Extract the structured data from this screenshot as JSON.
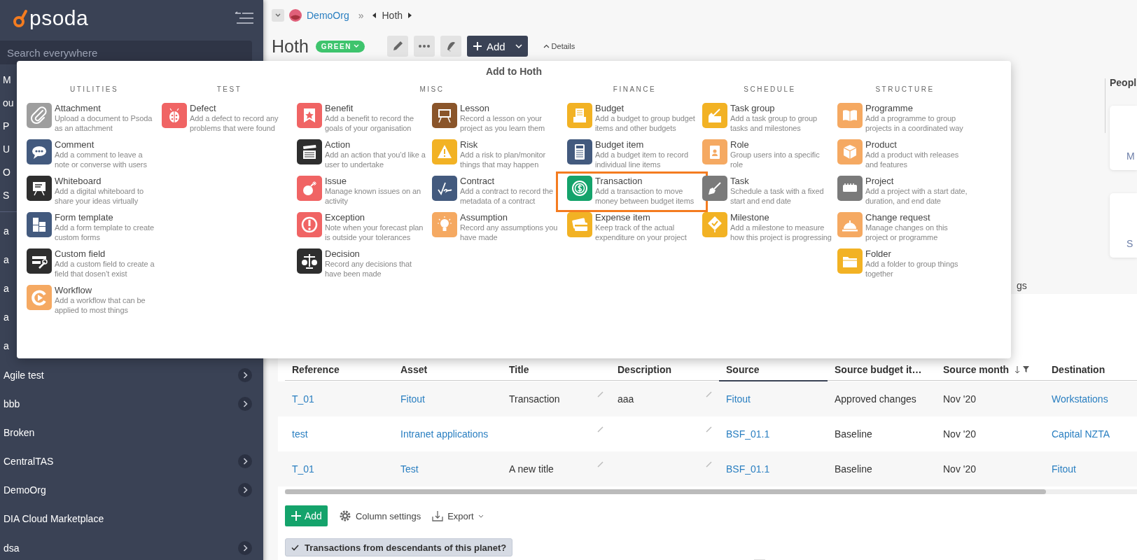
{
  "sidebar": {
    "logo": "psoda",
    "search": {
      "placeholder": "Search everywhere"
    },
    "fragments": [
      "M",
      "ou",
      "P",
      "U",
      "O",
      "S"
    ],
    "covered_items": [
      "a",
      "a",
      "a",
      "a",
      "a"
    ],
    "items": [
      {
        "label": "Agile test",
        "has_children": true
      },
      {
        "label": "bbb",
        "has_children": true
      },
      {
        "label": "Broken",
        "has_children": false
      },
      {
        "label": "CentralTAS",
        "has_children": true
      },
      {
        "label": "DemoOrg",
        "has_children": true
      },
      {
        "label": "DIA Cloud Marketplace",
        "has_children": false
      },
      {
        "label": "dsa",
        "has_children": true
      }
    ]
  },
  "breadcrumb": {
    "org": "DemoOrg",
    "separator": "»",
    "current": "Hoth"
  },
  "page": {
    "title": "Hoth",
    "status": {
      "label": "GREEN",
      "color": "#3ec46d"
    },
    "add_button": "Add",
    "details_link": "Details"
  },
  "side_panel": {
    "label_fragment": "gs",
    "heading": "Peopl",
    "cards": [
      "M",
      "S"
    ]
  },
  "add_menu": {
    "title": "Add to Hoth",
    "sections": [
      {
        "title": "UTILITIES",
        "columns": [
          [
            {
              "label": "Attachment",
              "description": "Upload a document to Psoda as an attachment",
              "color": "#9e9e9e",
              "highlighted": false
            },
            {
              "label": "Comment",
              "description": "Add a comment to leave a note or converse with users",
              "color": "#435a7e",
              "highlighted": false
            },
            {
              "label": "Whiteboard",
              "description": "Add a digital whiteboard to share your ideas virtually",
              "color": "#2e2e2e",
              "highlighted": false
            },
            {
              "label": "Form template",
              "description": "Add a form template to create custom forms",
              "color": "#435a7e",
              "highlighted": false
            },
            {
              "label": "Custom field",
              "description": "Add a custom field to create a field that dosen’t exist",
              "color": "#2e2e2e",
              "highlighted": false
            },
            {
              "label": "Workflow",
              "description": "Add a workflow that can be applied to most things",
              "color": "#f5a962",
              "highlighted": false
            }
          ]
        ]
      },
      {
        "title": "TEST",
        "columns": [
          [
            {
              "label": "Defect",
              "description": "Add a defect to record any problems that were found",
              "color": "#f06464",
              "highlighted": false
            }
          ]
        ]
      },
      {
        "title": "MISC",
        "columns": [
          [
            {
              "label": "Benefit",
              "description": "Add a benefit to record the goals of your organisation",
              "color": "#f06464",
              "highlighted": false
            },
            {
              "label": "Action",
              "description": "Add an action that you’d like a user to undertake",
              "color": "#2e2e2e",
              "highlighted": false
            },
            {
              "label": "Issue",
              "description": "Manage known issues on an activity",
              "color": "#f06464",
              "highlighted": false
            },
            {
              "label": "Exception",
              "description": "Note when your forecast plan is outside your tolerances",
              "color": "#f06464",
              "highlighted": false
            },
            {
              "label": "Decision",
              "description": "Record any decisions that have been made",
              "color": "#2e2e2e",
              "highlighted": false
            }
          ],
          [
            {
              "label": "Lesson",
              "description": "Record a lesson on your project as you learn them",
              "color": "#8a552a",
              "highlighted": false
            },
            {
              "label": "Risk",
              "description": "Add a risk to plan/monitor things that may happen",
              "color": "#f2b224",
              "highlighted": false
            },
            {
              "label": "Contract",
              "description": "Add a contract to record the metadata of a contract",
              "color": "#435a7e",
              "highlighted": false
            },
            {
              "label": "Assumption",
              "description": "Record any assumptions you have made",
              "color": "#f5a962",
              "highlighted": false
            }
          ]
        ]
      },
      {
        "title": "FINANCE",
        "columns": [
          [
            {
              "label": "Budget",
              "description": "Add a budget to group budget items and other budgets",
              "color": "#f2b224",
              "highlighted": false
            },
            {
              "label": "Budget item",
              "description": "Add a budget item to record individual line items",
              "color": "#435a7e",
              "highlighted": false
            },
            {
              "label": "Transaction",
              "description": "Add a transaction to move money between budget items",
              "color": "#14a36b",
              "highlighted": true
            },
            {
              "label": "Expense item",
              "description": "Keep track of the actual expenditure on your project",
              "color": "#f2b224",
              "highlighted": false
            }
          ]
        ]
      },
      {
        "title": "SCHEDULE",
        "columns": [
          [
            {
              "label": "Task group",
              "description": "Add a task group to group tasks and milestones",
              "color": "#f2b224",
              "highlighted": false
            },
            {
              "label": "Role",
              "description": "Group users into a specific role",
              "color": "#f5a962",
              "highlighted": false
            },
            {
              "label": "Task",
              "description": "Schedule a task with a fixed start and end date",
              "color": "#7a7a7a",
              "highlighted": false
            },
            {
              "label": "Milestone",
              "description": "Add a milestone to measure how this project is progressing",
              "color": "#f2b224",
              "highlighted": false
            }
          ]
        ]
      },
      {
        "title": "STRUCTURE",
        "columns": [
          [
            {
              "label": "Programme",
              "description": "Add a programme to group projects in a coordinated way",
              "color": "#f5a962",
              "highlighted": false
            },
            {
              "label": "Product",
              "description": "Add a product with releases and features",
              "color": "#f5a962",
              "highlighted": false
            },
            {
              "label": "Project",
              "description": "Add a project with a start date, duration, and end date",
              "color": "#7a7a7a",
              "highlighted": false
            },
            {
              "label": "Change request",
              "description": "Manage changes on this project or programme",
              "color": "#f5a962",
              "highlighted": false
            },
            {
              "label": "Folder",
              "description": "Add a folder to group things together",
              "color": "#f2b224",
              "highlighted": false
            }
          ]
        ]
      }
    ]
  },
  "table": {
    "columns": [
      {
        "label": "Reference",
        "kind": "link",
        "active": false,
        "sorted": false
      },
      {
        "label": "Asset",
        "kind": "link",
        "active": false,
        "sorted": false
      },
      {
        "label": "Title",
        "kind": "editable",
        "active": false,
        "sorted": false
      },
      {
        "label": "Description",
        "kind": "editable",
        "active": false,
        "sorted": false
      },
      {
        "label": "Source",
        "kind": "link",
        "active": true,
        "sorted": false
      },
      {
        "label": "Source budget it…",
        "kind": "text",
        "active": false,
        "sorted": false
      },
      {
        "label": "Source month",
        "kind": "text",
        "active": false,
        "sorted": true
      },
      {
        "label": "Destination",
        "kind": "link",
        "active": false,
        "sorted": false
      }
    ],
    "rows": [
      {
        "cells": [
          "T_01",
          "Fitout",
          "Transaction",
          "aaa",
          "Fitout",
          "Approved changes",
          "Nov '20",
          "Workstations"
        ]
      },
      {
        "cells": [
          "test",
          "Intranet applications",
          "",
          "",
          "BSF_01.1",
          "Baseline",
          "Nov '20",
          "Capital NZTA"
        ]
      },
      {
        "cells": [
          "T_01",
          "Test",
          "A new title",
          "",
          "BSF_01.1",
          "Baseline",
          "Nov '20",
          "Fitout"
        ]
      }
    ],
    "toolbar": {
      "add": "Add",
      "column_settings": "Column settings",
      "export": "Export"
    },
    "filter": {
      "label": "Transactions from descendants of this planet?",
      "checked": true
    }
  }
}
